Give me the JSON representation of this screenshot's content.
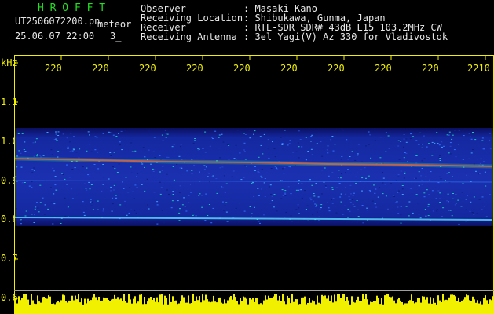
{
  "header": {
    "app_name": "H R O F F T",
    "filename": "UT2506072200.pn",
    "mode": "meteor",
    "datetime": "25.06.07 22:00",
    "counter": "3_"
  },
  "station_info": [
    {
      "label": "Observer",
      "value": ": Masaki Kano"
    },
    {
      "label": "Receiving Location",
      "value": ": Shibukawa, Gunma, Japan"
    },
    {
      "label": "Receiver",
      "value": ": RTL-SDR SDR# 43dB L15 103.2MHz CW"
    },
    {
      "label": "Receiving Antenna",
      "value": ": 3el Yagi(V) Az 330 for Vladivostok"
    }
  ],
  "axes": {
    "y_unit": "kHz",
    "y_ticks": [
      "1.1",
      "1.0",
      "0.9",
      "0.8",
      "0.7",
      "0.6"
    ],
    "time_ticks": [
      "220",
      "220",
      "220",
      "220",
      "220",
      "220",
      "220",
      "220",
      "220",
      "2210"
    ]
  },
  "colors": {
    "background": "#000000",
    "noise_band": "#1a2fb0",
    "signal_line": "#ff3030",
    "amplitude": "#f0f000",
    "labels": "#f0f000",
    "title": "#20e020"
  },
  "spectrogram": {
    "freq_range_khz": [
      0.6,
      1.12
    ],
    "noise_band_khz": [
      0.79,
      1.01
    ],
    "carrier_line_start_khz": 0.955,
    "carrier_line_end_khz": 0.935,
    "secondary_line_khz": 0.8
  }
}
